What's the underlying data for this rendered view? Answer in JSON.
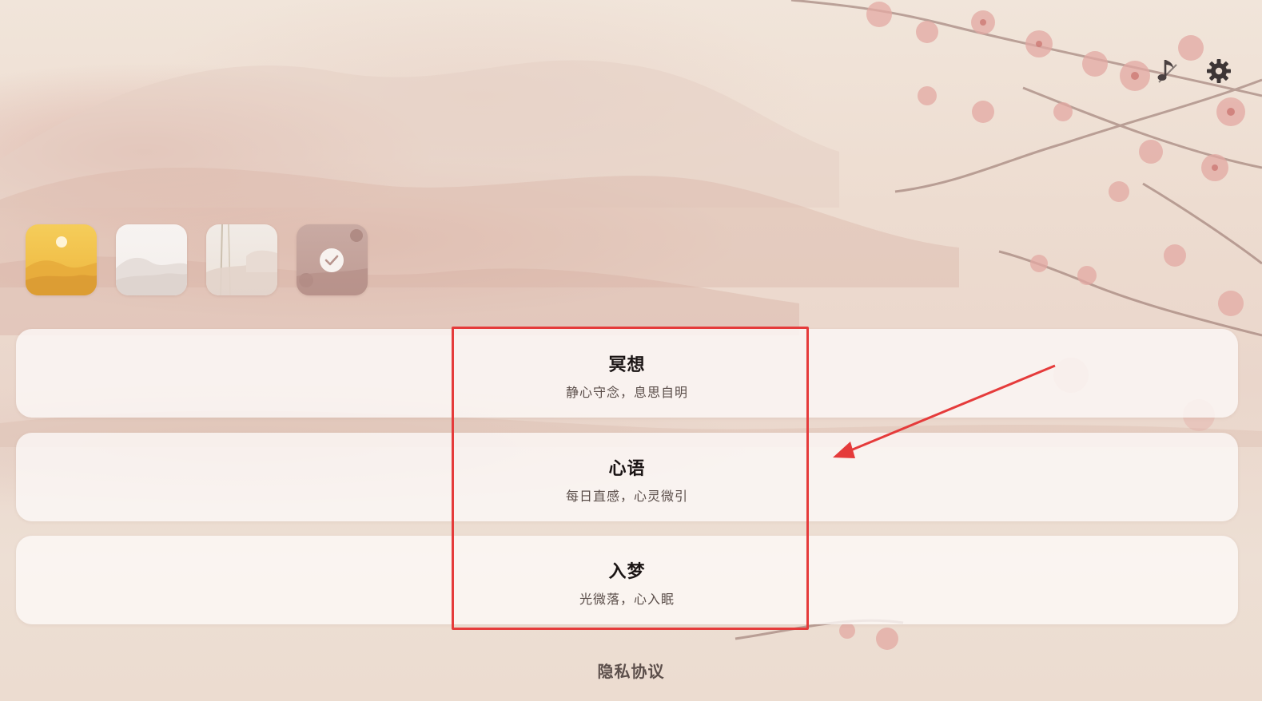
{
  "header": {
    "music_icon": "music-note-icon",
    "settings_icon": "gear-icon"
  },
  "themes": [
    {
      "name": "theme-golden-sunrise",
      "selected": false
    },
    {
      "name": "theme-white-mist-mountains",
      "selected": false
    },
    {
      "name": "theme-bamboo-mist",
      "selected": false
    },
    {
      "name": "theme-rose-blossom",
      "selected": true
    }
  ],
  "modes": [
    {
      "title": "冥想",
      "subtitle": "静心守念，息思自明"
    },
    {
      "title": "心语",
      "subtitle": "每日直感，心灵微引"
    },
    {
      "title": "入梦",
      "subtitle": "光微落，心入眠"
    }
  ],
  "footer": {
    "privacy_label": "隐私协议"
  },
  "colors": {
    "highlight": "#e53b3b",
    "background": "#eddcd0",
    "card": "#fcf9f7",
    "title_text": "#1a1414"
  }
}
